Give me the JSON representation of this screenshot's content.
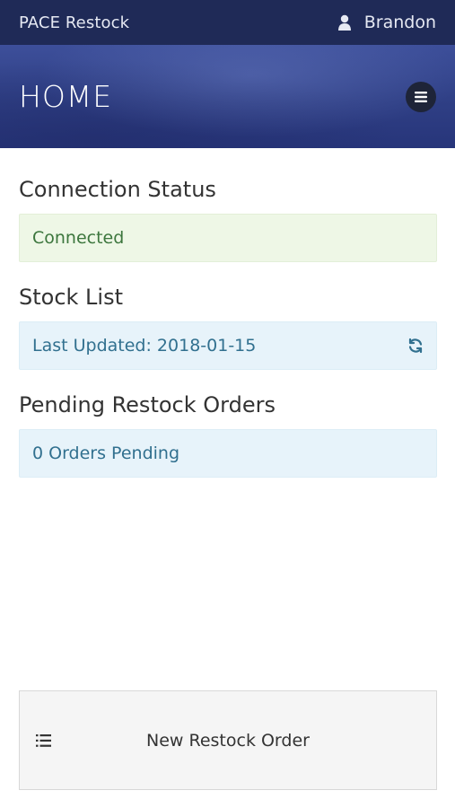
{
  "topbar": {
    "brand": "PACE Restock",
    "user_name": "Brandon",
    "user_icon": "user-icon"
  },
  "hero": {
    "title": "HOME",
    "menu_icon": "hamburger-menu-icon"
  },
  "sections": {
    "connection": {
      "title": "Connection Status",
      "status": "Connected"
    },
    "stock_list": {
      "title": "Stock List",
      "last_updated": "Last Updated: 2018-01-15",
      "refresh_icon": "refresh-icon"
    },
    "pending": {
      "title": "Pending Restock Orders",
      "count_text": "0 Orders Pending"
    }
  },
  "actions": {
    "new_order_label": "New Restock Order",
    "new_order_icon": "list-icon"
  },
  "colors": {
    "topbar_bg": "#1f2a57",
    "hero_bg": "#3d4f9a",
    "success_bg": "#eef7e6",
    "success_text": "#3c763d",
    "info_bg": "#e7f3fa",
    "info_text": "#31708f"
  }
}
